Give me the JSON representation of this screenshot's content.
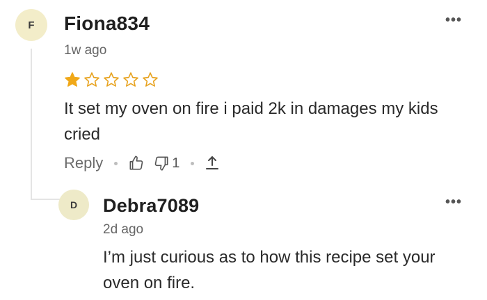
{
  "comment": {
    "avatar_initial": "F",
    "username": "Fiona834",
    "time": "1w ago",
    "rating": 1,
    "rating_max": 5,
    "text": "It set my oven on fire i paid 2k in damages my kids cried",
    "actions": {
      "reply_label": "Reply",
      "dislike_count": "1"
    },
    "more_label": "•••"
  },
  "reply": {
    "avatar_initial": "D",
    "username": "Debra7089",
    "time": "2d ago",
    "text": "I’m just curious as to how this recipe set your oven on fire.",
    "more_label": "•••"
  },
  "colors": {
    "star_filled": "#f0a818",
    "star_outline": "#e7a21e",
    "avatar_bg": "#f3edc9"
  }
}
